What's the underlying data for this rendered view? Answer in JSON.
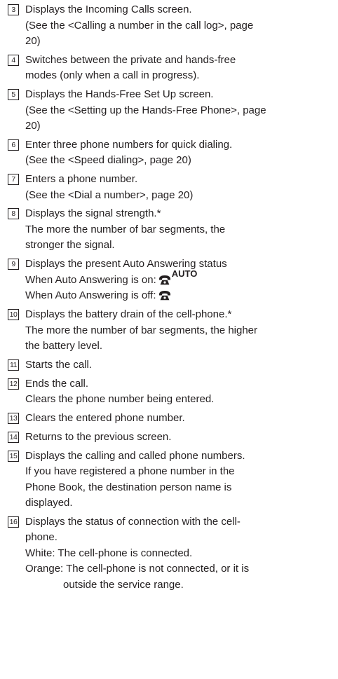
{
  "items": [
    {
      "num": "3",
      "lines": [
        "Displays the Incoming Calls screen.",
        "(See the <Calling a number in the call log>, page",
        "20)"
      ]
    },
    {
      "num": "4",
      "lines": [
        "Switches between the private and hands-free",
        "modes (only when a call in progress)."
      ]
    },
    {
      "num": "5",
      "lines": [
        "Displays the Hands-Free Set Up screen.",
        "(See the <Setting up the Hands-Free Phone>, page",
        "20)"
      ]
    },
    {
      "num": "6",
      "lines": [
        "Enter three phone numbers for quick dialing.",
        "(See the <Speed dialing>, page 20)"
      ]
    },
    {
      "num": "7",
      "lines": [
        "Enters a phone number.",
        "(See the <Dial a number>, page 20)"
      ]
    },
    {
      "num": "8",
      "lines": [
        "Displays the signal strength.*",
        "The more the number of bar segments, the",
        "stronger the signal."
      ]
    },
    {
      "num": "9",
      "lines": [
        "Displays the present Auto Answering status"
      ],
      "on_text": "When Auto Answering is on:",
      "auto_label": "AUTO",
      "off_text": "When Auto Answering is off:"
    },
    {
      "num": "10",
      "lines": [
        "Displays the battery drain of the cell-phone.*",
        "The more the number of bar segments, the higher",
        "the battery level."
      ]
    },
    {
      "num": "11",
      "lines": [
        "Starts the call."
      ]
    },
    {
      "num": "12",
      "lines": [
        "Ends the call.",
        "Clears the phone number being entered."
      ]
    },
    {
      "num": "13",
      "lines": [
        "Clears the entered phone number."
      ]
    },
    {
      "num": "14",
      "lines": [
        "Returns to the previous screen."
      ]
    },
    {
      "num": "15",
      "lines": [
        "Displays the calling and called phone numbers.",
        "If you have registered a phone number in the",
        "Phone Book, the destination person name is",
        "displayed."
      ]
    },
    {
      "num": "16",
      "lines": [
        "Displays the status of connection with the cell-",
        "phone.",
        "White: The cell-phone is connected.",
        "Orange: The cell-phone is not connected, or it is"
      ],
      "hang_line": "outside the service range."
    }
  ],
  "icons": {
    "phone": "telephone-handset-icon"
  }
}
